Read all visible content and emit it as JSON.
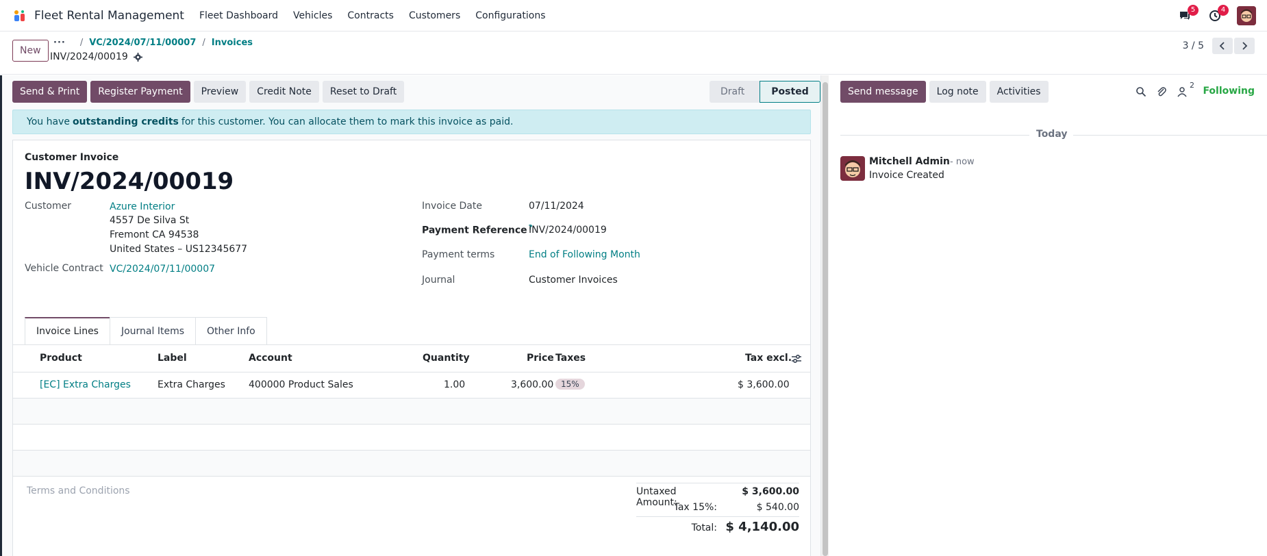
{
  "navbar": {
    "app_name": "Fleet Rental Management",
    "menu": [
      "Fleet Dashboard",
      "Vehicles",
      "Contracts",
      "Customers",
      "Configurations"
    ],
    "messages_badge": "5",
    "activities_badge": "4"
  },
  "control": {
    "new_label": "New",
    "breadcrumb_dots": "···",
    "breadcrumb": [
      "VC/2024/07/11/00007",
      "Invoices"
    ],
    "current": "INV/2024/00019",
    "pager": "3 / 5"
  },
  "actions": {
    "send_print": "Send & Print",
    "register_payment": "Register Payment",
    "preview": "Preview",
    "credit_note": "Credit Note",
    "reset_to_draft": "Reset to Draft"
  },
  "status": {
    "draft": "Draft",
    "posted": "Posted"
  },
  "alert": {
    "prefix": "You have",
    "bold": "outstanding credits",
    "suffix": "for this customer. You can allocate them to mark this invoice as paid."
  },
  "invoice": {
    "type": "Customer Invoice",
    "number": "INV/2024/00019",
    "customer_label": "Customer",
    "customer_name": "Azure Interior",
    "address_line1": "4557 De Silva St",
    "address_line2": "Fremont CA 94538",
    "address_line3": "United States – US12345677",
    "vehicle_contract_label": "Vehicle Contract",
    "vehicle_contract": "VC/2024/07/11/00007",
    "invoice_date_label": "Invoice Date",
    "invoice_date": "07/11/2024",
    "payment_ref_label": "Payment Reference",
    "payment_ref_help": "?",
    "payment_ref": "INV/2024/00019",
    "payment_terms_label": "Payment terms",
    "payment_terms": "End of Following Month",
    "journal_label": "Journal",
    "journal": "Customer Invoices"
  },
  "tabs": [
    "Invoice Lines",
    "Journal Items",
    "Other Info"
  ],
  "lines": {
    "headers": {
      "product": "Product",
      "label": "Label",
      "account": "Account",
      "quantity": "Quantity",
      "price": "Price",
      "taxes": "Taxes",
      "tax_excl": "Tax excl."
    },
    "rows": [
      {
        "product": "[EC] Extra Charges",
        "label": "Extra Charges",
        "account": "400000 Product Sales",
        "quantity": "1.00",
        "price": "3,600.00",
        "tax": "15%",
        "tax_excl": "$ 3,600.00"
      }
    ]
  },
  "terms_placeholder": "Terms and Conditions",
  "totals": {
    "untaxed_label": "Untaxed Amount:",
    "untaxed": "$ 3,600.00",
    "tax_label": "Tax 15%:",
    "tax": "$ 540.00",
    "total_label": "Total:",
    "total": "$ 4,140.00"
  },
  "chatter": {
    "send_message": "Send message",
    "log_note": "Log note",
    "activities": "Activities",
    "followers_count": "2",
    "following": "Following",
    "today": "Today",
    "message": {
      "author": "Mitchell Admin",
      "time": "- now",
      "body": "Invoice Created"
    }
  },
  "colors": {
    "primary": "#714b67",
    "link": "#017e84",
    "following": "#28a745",
    "alert_bg": "#cfedf2"
  }
}
